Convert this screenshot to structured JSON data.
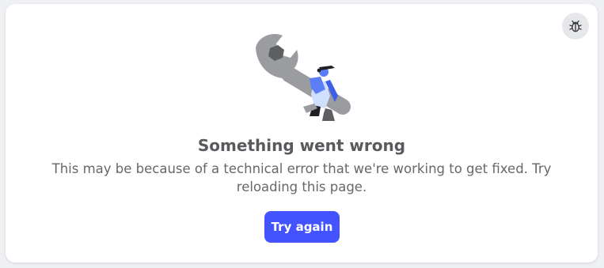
{
  "error": {
    "title": "Something went wrong",
    "description": "This may be because of a technical error that we're working to get fixed. Try reloading this page.",
    "retry_label": "Try again"
  },
  "icons": {
    "bug": "bug-icon",
    "illustration": "wrench-person-illustration"
  },
  "colors": {
    "primary": "#4353ff",
    "title_text": "#5a5a5e",
    "body_text": "#65676b",
    "wrench": "#9a9ca0",
    "person": "#5b7df5"
  }
}
